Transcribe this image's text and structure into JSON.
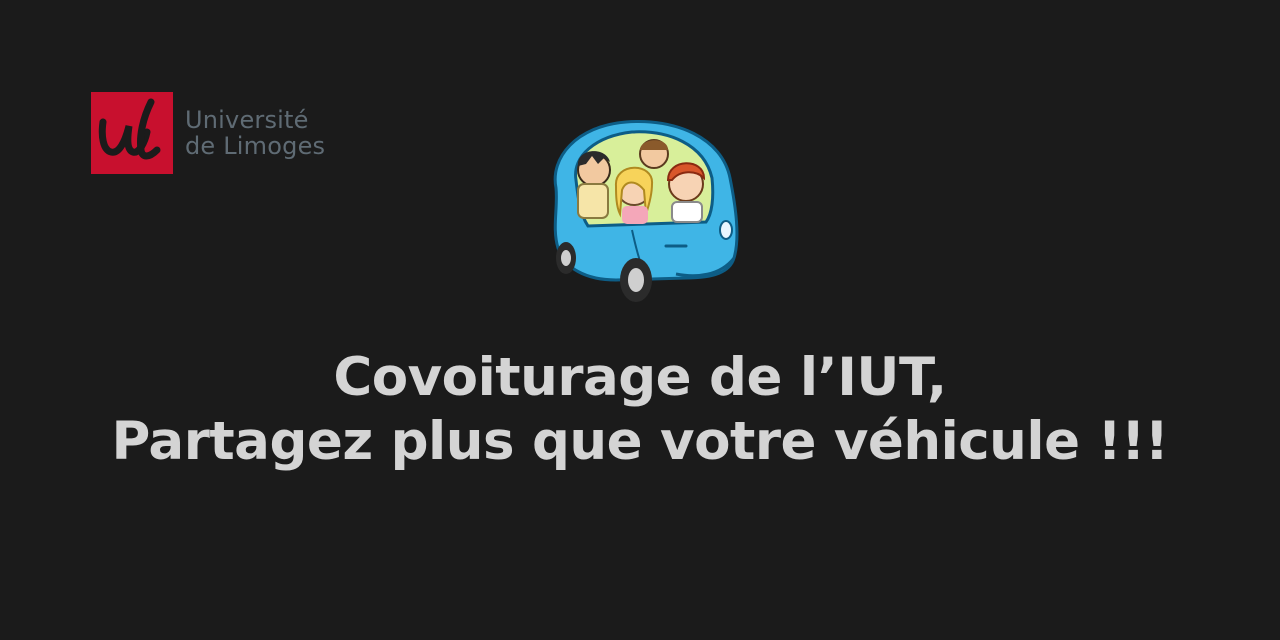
{
  "logo": {
    "line1": "Université",
    "line2": "de Limoges",
    "mark_text": "ul",
    "brand_color": "#c8102e",
    "text_color": "#5f6b74"
  },
  "illustration": {
    "icon": "carpool-car-illustration",
    "body_color": "#3fb5e6"
  },
  "headline": {
    "line1": "Covoiturage de l’IUT,",
    "line2": "Partagez plus que votre véhicule !!!"
  }
}
